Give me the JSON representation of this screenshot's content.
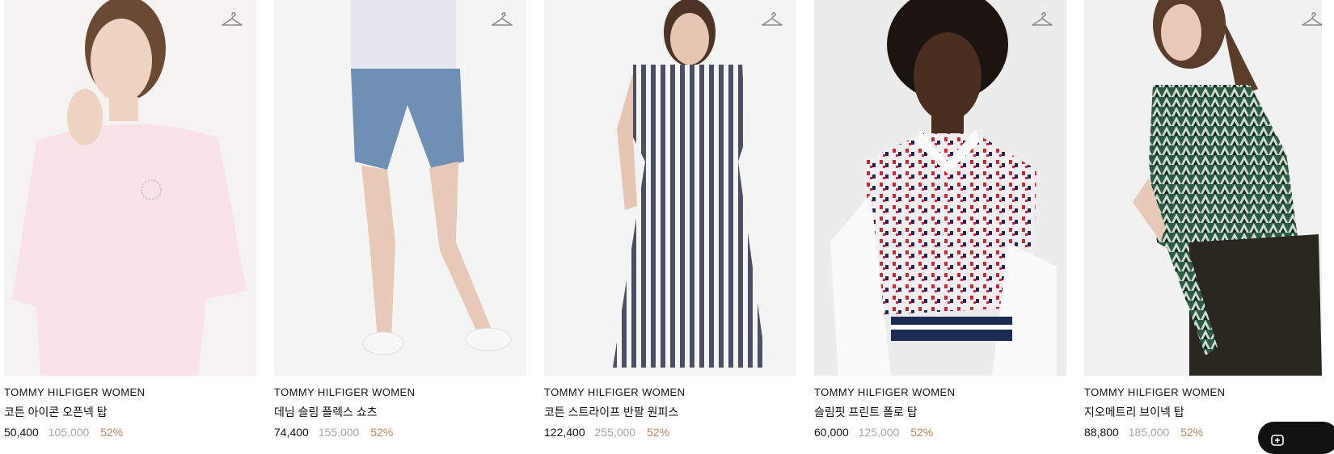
{
  "products": [
    {
      "brand": "TOMMY HILFIGER WOMEN",
      "name": "코튼 아이콘 오픈넥 탑",
      "sale_price": "50,400",
      "original_price": "105,000",
      "discount": "52%"
    },
    {
      "brand": "TOMMY HILFIGER WOMEN",
      "name": "데님 슬림 플렉스 쇼츠",
      "sale_price": "74,400",
      "original_price": "155,000",
      "discount": "52%"
    },
    {
      "brand": "TOMMY HILFIGER WOMEN",
      "name": "코튼 스트라이프 반팔 원피스",
      "sale_price": "122,400",
      "original_price": "255,000",
      "discount": "52%"
    },
    {
      "brand": "TOMMY HILFIGER WOMEN",
      "name": "슬림핏 프린트 폴로 탑",
      "sale_price": "60,000",
      "original_price": "125,000",
      "discount": "52%"
    },
    {
      "brand": "TOMMY HILFIGER WOMEN",
      "name": "지오메트리 브이넥 탑",
      "sale_price": "88,800",
      "original_price": "185,000",
      "discount": "52%"
    }
  ],
  "icons": {
    "wishlist": "hanger-icon",
    "floating_button": "chat-icon"
  },
  "colors": {
    "discount": "#b48a60",
    "original_price": "#a8a8a8",
    "text": "#111111"
  }
}
